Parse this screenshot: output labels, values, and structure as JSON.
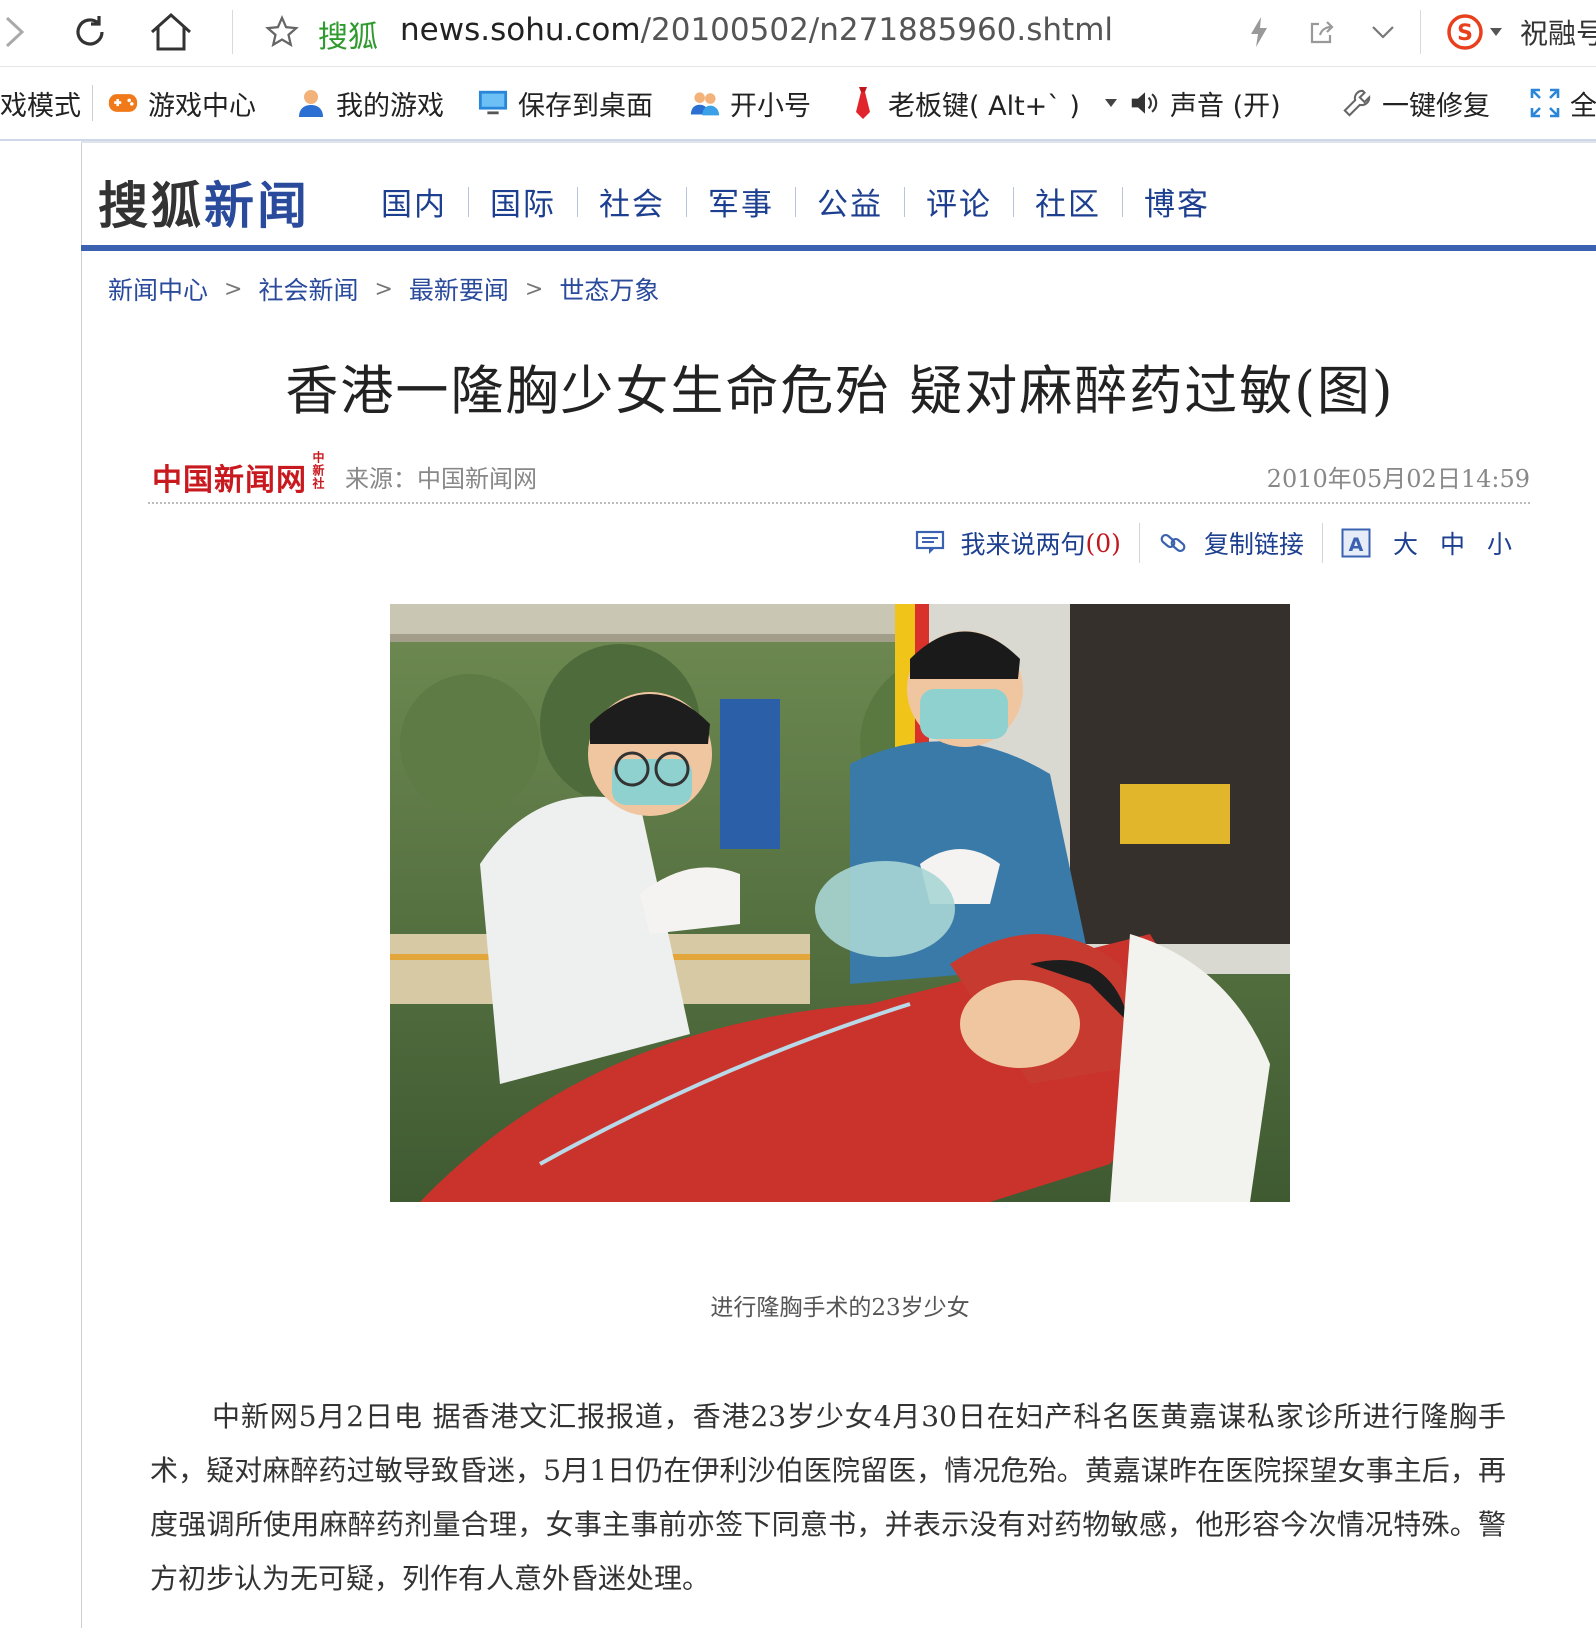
{
  "browser": {
    "url_site_label": "搜狐",
    "url_domain": "news.sohu.com",
    "url_path": "/20100502/n271885960.shtml",
    "extension_label": "祝融号"
  },
  "favorites": [
    {
      "label": "戏模式",
      "icon": "none"
    },
    {
      "label": "游戏中心",
      "icon": "gamepad-icon"
    },
    {
      "label": "我的游戏",
      "icon": "user-icon"
    },
    {
      "label": "保存到桌面",
      "icon": "monitor-icon"
    },
    {
      "label": "开小号",
      "icon": "users-icon"
    },
    {
      "label": "老板键( Alt+` )",
      "icon": "tie-icon"
    },
    {
      "label": "声音 (开)",
      "icon": "speaker-icon"
    },
    {
      "label": "一键修复",
      "icon": "wrench-icon"
    },
    {
      "label": "全",
      "icon": "fullscreen-icon"
    }
  ],
  "site": {
    "logo_part1": "搜狐",
    "logo_part2": "新闻",
    "nav": [
      "国内",
      "国际",
      "社会",
      "军事",
      "公益",
      "评论",
      "社区",
      "博客"
    ]
  },
  "breadcrumb": [
    "新闻中心",
    "社会新闻",
    "最新要闻",
    "世态万象"
  ],
  "article": {
    "title": "香港一隆胸少女生命危殆 疑对麻醉药过敏(图)",
    "source_logo": "中国新闻网",
    "source_logo_small": "中新社",
    "source": "来源：中国新闻网",
    "date": "2010年05月02日14:59",
    "photo_alt": "进行隆胸手术的23岁少女",
    "caption": "进行隆胸手术的23岁少女",
    "body": "中新网5月2日电 据香港文汇报报道，香港23岁少女4月30日在妇产科名医黄嘉谋私家诊所进行隆胸手术，疑对麻醉药过敏导致昏迷，5月1日仍在伊利沙伯医院留医，情况危殆。黄嘉谋昨在医院探望女事主后，再度强调所使用麻醉药剂量合理，女事主事前亦签下同意书，并表示没有对药物敏感，他形容今次情况特殊。警方初步认为无可疑，列作有人意外昏迷处理。"
  },
  "tools": {
    "comment_label": "我来说两句",
    "comment_count": "(0)",
    "copy_link": "复制链接",
    "size_large": "大",
    "size_medium": "中",
    "size_small": "小"
  },
  "colors": {
    "nav_blue": "#1d3f8f",
    "rule_blue": "#3a62b0",
    "cn_red": "#c8191f",
    "site_green": "#2f9b2f"
  }
}
